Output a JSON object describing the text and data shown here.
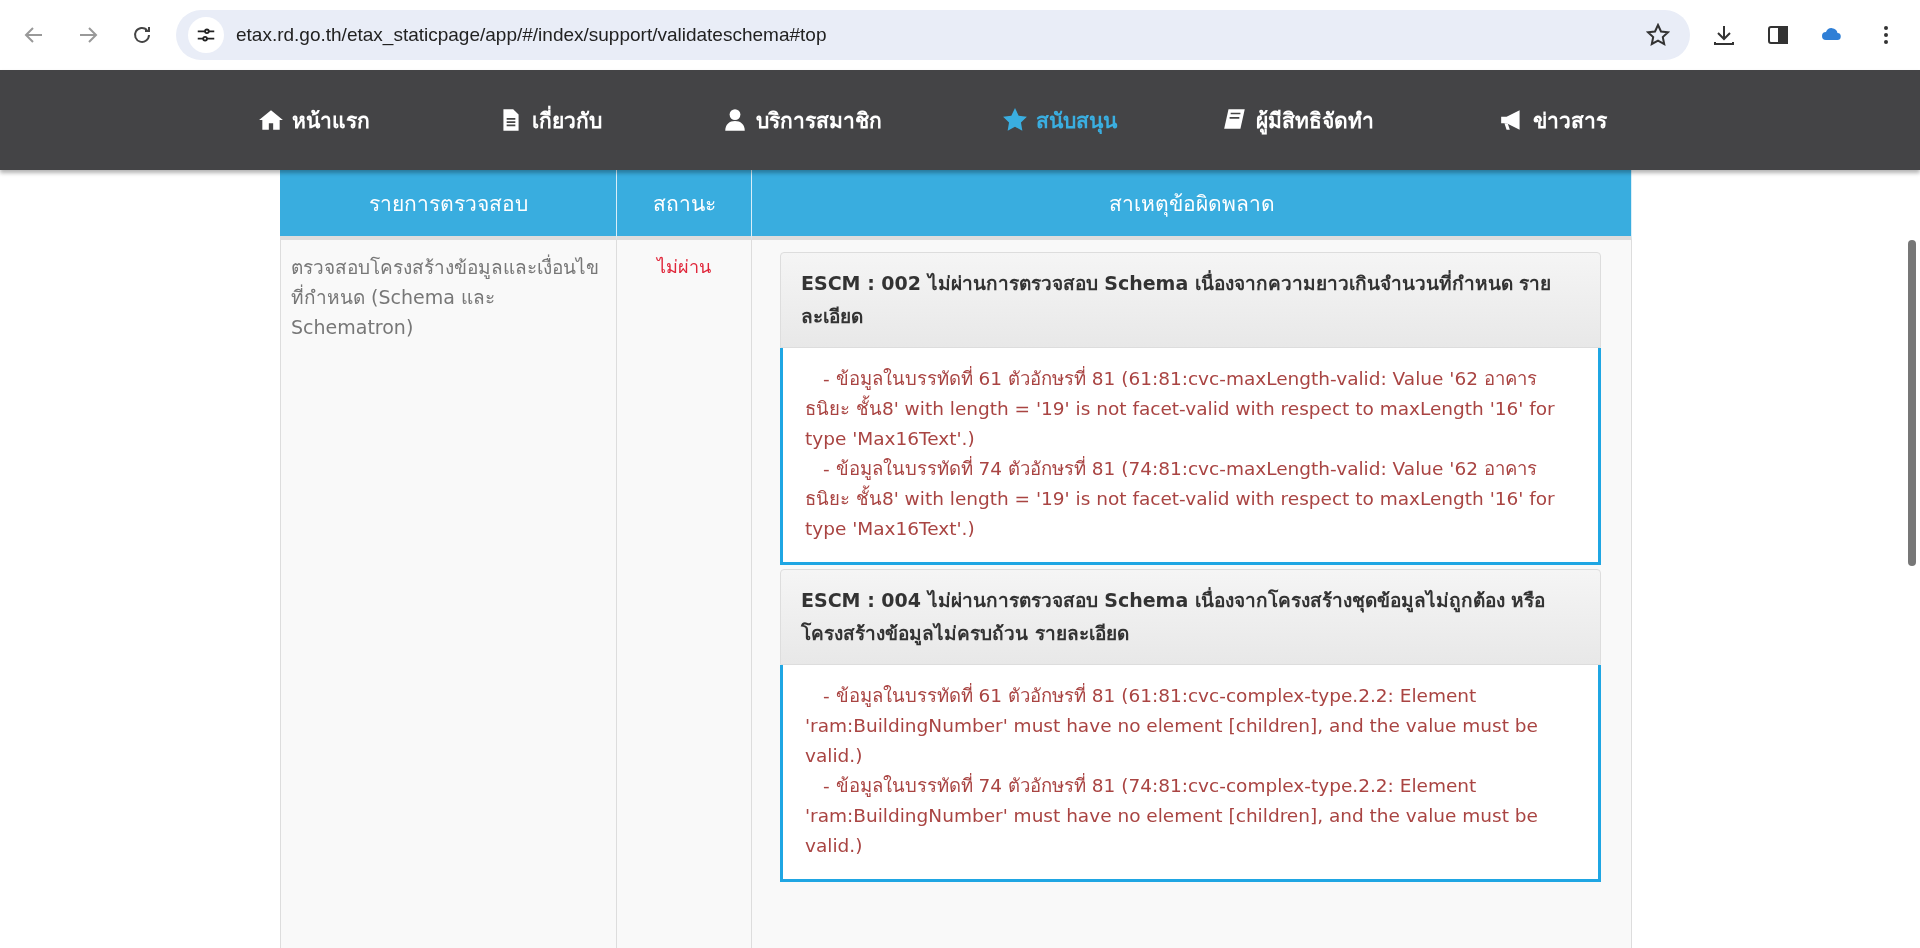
{
  "browser": {
    "url": "etax.rd.go.th/etax_staticpage/app/#/index/support/validateschema#top"
  },
  "nav": {
    "items": [
      {
        "label": "หน้าแรก",
        "selected": false
      },
      {
        "label": "เกี่ยวกับ",
        "selected": false
      },
      {
        "label": "บริการสมาชิก",
        "selected": false
      },
      {
        "label": "สนับสนุน",
        "selected": true
      },
      {
        "label": "ผู้มีสิทธิจัดทำ",
        "selected": false
      },
      {
        "label": "ข่าวสาร",
        "selected": false
      }
    ]
  },
  "table": {
    "columns": [
      "รายการตรวจสอบ",
      "สถานะ",
      "สาเหตุข้อผิดพลาด"
    ],
    "rows": [
      {
        "item": "ตรวจสอบโครงสร้างข้อมูลและเงื่อนไขที่กำหนด (Schema และ Schematron)",
        "status": "ไม่ผ่าน",
        "errors": [
          {
            "title": "ESCM : 002 ไม่ผ่านการตรวจสอบ Schema เนื่องจากความยาวเกินจำนวนที่กำหนด รายละเอียด",
            "details": [
              "- ข้อมูลในบรรทัดที่ 61 ตัวอักษรที่ 81 (61:81:cvc-maxLength-valid: Value '62 อาคาร ธนิยะ ชั้น8' with length = '19' is not facet-valid with respect to maxLength '16' for type 'Max16Text'.)",
              "- ข้อมูลในบรรทัดที่ 74 ตัวอักษรที่ 81 (74:81:cvc-maxLength-valid: Value '62 อาคาร ธนิยะ ชั้น8' with length = '19' is not facet-valid with respect to maxLength '16' for type 'Max16Text'.)"
            ]
          },
          {
            "title": "ESCM : 004 ไม่ผ่านการตรวจสอบ Schema เนื่องจากโครงสร้างชุดข้อมูลไม่ถูกต้อง หรือโครงสร้างข้อมูลไม่ครบถ้วน รายละเอียด",
            "details": [
              "- ข้อมูลในบรรทัดที่ 61 ตัวอักษรที่ 81 (61:81:cvc-complex-type.2.2: Element 'ram:BuildingNumber' must have no element [children], and the value must be valid.)",
              "- ข้อมูลในบรรทัดที่ 74 ตัวอักษรที่ 81 (74:81:cvc-complex-type.2.2: Element 'ram:BuildingNumber' must have no element [children], and the value must be valid.)"
            ]
          }
        ]
      }
    ]
  }
}
